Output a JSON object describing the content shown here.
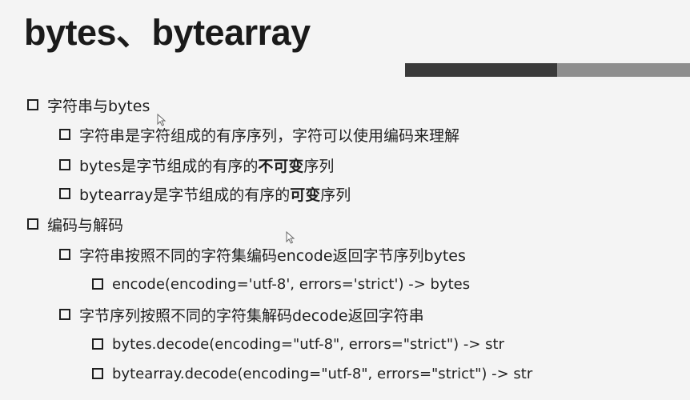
{
  "slide": {
    "title": "bytes、bytearray",
    "items": [
      {
        "text": "字符串与bytes"
      },
      {
        "text": "字符串是字符组成的有序序列，字符可以使用编码来理解"
      },
      {
        "pre": "bytes是字节组成的有序的",
        "bold": "不可变",
        "post": "序列"
      },
      {
        "pre": "bytearray是字节组成的有序的",
        "bold": "可变",
        "post": "序列"
      },
      {
        "text": "编码与解码"
      },
      {
        "text": "字符串按照不同的字符集编码encode返回字节序列bytes"
      },
      {
        "text": "encode(encoding='utf-8', errors='strict') -> bytes"
      },
      {
        "text": "字节序列按照不同的字符集解码decode返回字符串"
      },
      {
        "text": "bytes.decode(encoding=\"utf-8\", errors=\"strict\") -> str"
      },
      {
        "text": "bytearray.decode(encoding=\"utf-8\", errors=\"strict\") -> str"
      }
    ]
  },
  "colors": {
    "background": "#f4f4f4",
    "text": "#1f1f1f",
    "accent_bar_dark": "#3a3a3a",
    "accent_bar_light": "#8e8e8e"
  },
  "icons": [
    "square-bullet-icon",
    "mouse-pointer-icon"
  ]
}
